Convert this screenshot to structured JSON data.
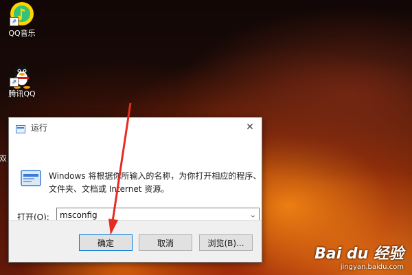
{
  "desktop": {
    "icons": [
      {
        "label": "QQ音乐"
      },
      {
        "label": "腾讯QQ"
      },
      {
        "label": "双"
      }
    ]
  },
  "dialog": {
    "title": "运行",
    "close_symbol": "✕",
    "description_line1": "Windows 将根据你所输入的名称，为你打开相应的程序、",
    "description_line2": "文件夹、文档或 Internet 资源。",
    "open_label": "打开(O):",
    "open_value": "msconfig",
    "buttons": {
      "ok": "确定",
      "cancel": "取消",
      "browse": "浏览(B)..."
    }
  },
  "watermark": {
    "logo": "Bai du 经验",
    "site": "jingyan.baidu.com"
  },
  "colors": {
    "focus_border": "#0078d7",
    "qq_music_green": "#31c27c",
    "arrow_red": "#e52b22"
  },
  "icons": {
    "run_icon": "run-icon",
    "close_icon": "close-icon",
    "dropdown_icon": "chevron-down-icon"
  }
}
